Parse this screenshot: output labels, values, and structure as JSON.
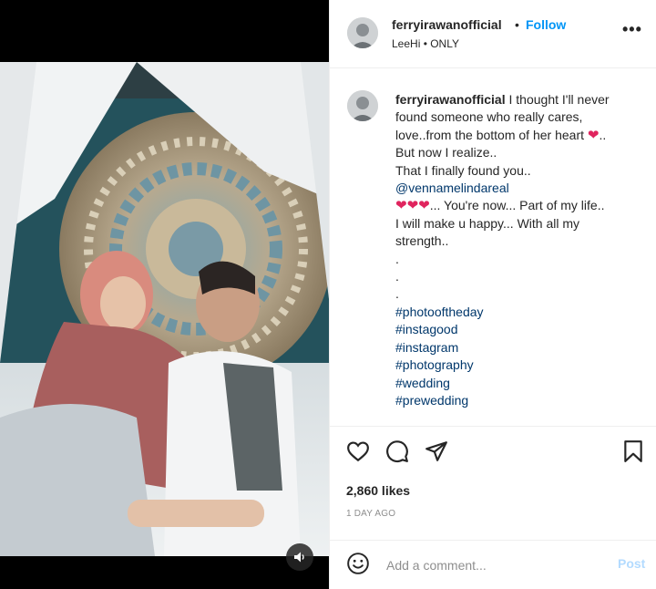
{
  "post": {
    "username": "ferryirawanofficial",
    "follow_label": "Follow",
    "separator": "•",
    "audio": "LeeHi • ONLY",
    "more_label": "•••"
  },
  "caption": {
    "username": "ferryirawanofficial",
    "lines": [
      "I thought I'll never",
      "found someone who really cares,",
      "love..from the bottom of her heart",
      "..",
      "But now I realize..",
      "That I finally found you..",
      "@vennamelindareal",
      "... You're now... Part of my life..",
      "I will make u happy... With all my",
      "strength..",
      ".",
      ".",
      "."
    ],
    "hearts": "❤",
    "triple_hearts": "❤❤❤",
    "hashtags": [
      "#photooftheday",
      "#instagood",
      "#instagram",
      "#photography",
      "#wedding",
      "#prewedding"
    ]
  },
  "stats": {
    "likes": "2,860 likes",
    "posted": "1 DAY AGO"
  },
  "comment": {
    "placeholder": "Add a comment...",
    "post_label": "Post"
  },
  "icons": {
    "like": "heart-outline-icon",
    "comment": "comment-bubble-icon",
    "share": "paper-plane-icon",
    "save": "bookmark-icon",
    "emoji": "smiley-icon",
    "audio": "speaker-icon",
    "more": "more-options-icon"
  },
  "colors": {
    "accent": "#0095f6",
    "link": "#00376b",
    "heart": "#e0245e",
    "muted": "#8e8e8e",
    "post_disabled": "#b3dbff"
  }
}
